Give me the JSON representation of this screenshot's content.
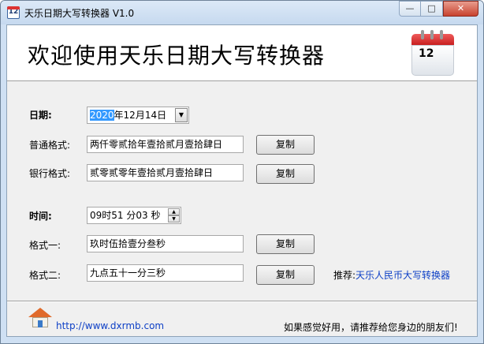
{
  "window": {
    "title": "天乐日期大写转换器 V1.0",
    "icon_text": "12",
    "controls": {
      "minimize": "—",
      "maximize": "□",
      "close": "✕"
    }
  },
  "header": {
    "banner": "欢迎使用天乐日期大写转换器",
    "calendar_icon_text": "12"
  },
  "date_section": {
    "label": "日期:",
    "year_selected": "2020",
    "rest": "年12月14日",
    "dropdown_arrow": "▼"
  },
  "normal_format": {
    "label": "普通格式:",
    "value": "两仟零贰拾年壹拾贰月壹拾肆日",
    "button": "复制"
  },
  "bank_format": {
    "label": "银行格式:",
    "value": "贰零贰零年壹拾贰月壹拾肆日",
    "button": "复制"
  },
  "time_section": {
    "label": "时间:",
    "value": "09时51 分03 秒",
    "spin_up": "▲",
    "spin_down": "▼"
  },
  "format1": {
    "label": "格式一:",
    "value": "玖时伍拾壹分叁秒",
    "button": "复制"
  },
  "format2": {
    "label": "格式二:",
    "value": "九点五十一分三秒",
    "button": "复制"
  },
  "recommend": {
    "label": "推荐:",
    "link": "天乐人民币大写转换器"
  },
  "footer": {
    "url": "http://www.dxrmb.com",
    "tagline": "如果感觉好用，请推荐给您身边的朋友们!"
  }
}
